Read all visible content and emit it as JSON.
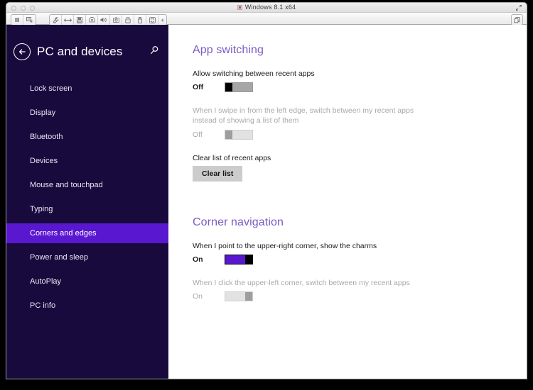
{
  "window": {
    "title": "Windows 8.1 x64",
    "title_icon": "windows-icon",
    "fullscreen_icon": "fullscreen-arrows-icon",
    "traffic_lights": [
      "close-button",
      "minimize-button",
      "maximize-button"
    ],
    "toolbar": {
      "left_group": [
        {
          "name": "pause-button",
          "icon": "pause-icon"
        },
        {
          "name": "snapshot-button",
          "icon": "snapshot-icon"
        }
      ],
      "main_group": [
        {
          "name": "settings-button",
          "icon": "wrench-icon"
        },
        {
          "name": "network-button",
          "icon": "arrows-horizontal-icon"
        },
        {
          "name": "hard-disk-button",
          "icon": "hard-disk-icon"
        },
        {
          "name": "cd-drive-button",
          "icon": "cd-drive-icon"
        },
        {
          "name": "sound-button",
          "icon": "speaker-icon"
        },
        {
          "name": "camera-button",
          "icon": "camera-icon"
        },
        {
          "name": "printer-button",
          "icon": "printer-icon"
        },
        {
          "name": "usb-button",
          "icon": "usb-icon"
        },
        {
          "name": "shared-folders-button",
          "icon": "sync-folders-icon"
        }
      ],
      "collapse_icon": "chevron-left-icon",
      "right_button": {
        "name": "unity-view-button",
        "icon": "windows-restore-icon"
      }
    }
  },
  "sidebar": {
    "back_icon": "back-arrow-icon",
    "title": "PC and devices",
    "search_icon": "search-icon",
    "items": [
      {
        "label": "Lock screen",
        "selected": false
      },
      {
        "label": "Display",
        "selected": false
      },
      {
        "label": "Bluetooth",
        "selected": false
      },
      {
        "label": "Devices",
        "selected": false
      },
      {
        "label": "Mouse and touchpad",
        "selected": false
      },
      {
        "label": "Typing",
        "selected": false
      },
      {
        "label": "Corners and edges",
        "selected": true
      },
      {
        "label": "Power and sleep",
        "selected": false
      },
      {
        "label": "AutoPlay",
        "selected": false
      },
      {
        "label": "PC info",
        "selected": false
      }
    ]
  },
  "main": {
    "sections": [
      {
        "title": "App switching",
        "settings": [
          {
            "label": "Allow switching between recent apps",
            "state": "Off",
            "on": false,
            "disabled": false,
            "dim": false
          },
          {
            "label": "When I swipe in from the left edge, switch between my recent apps instead of showing a list of them",
            "state": "Off",
            "on": false,
            "disabled": true,
            "dim": true
          }
        ],
        "action": {
          "label": "Clear list of recent apps",
          "button": "Clear list"
        }
      },
      {
        "title": "Corner navigation",
        "settings": [
          {
            "label": "When I point to the upper-right corner, show the charms",
            "state": "On",
            "on": true,
            "disabled": false,
            "dim": false
          },
          {
            "label": "When I click the upper-left corner, switch between my recent apps",
            "state": "On",
            "on": true,
            "disabled": true,
            "dim": true
          }
        ]
      }
    ]
  },
  "colors": {
    "sidebar_bg": "#190a3d",
    "sidebar_selected": "#5a17d0",
    "heading_purple": "#7a5bc4",
    "toggle_on": "#5a17d0",
    "content_bg": "#ffffff"
  }
}
